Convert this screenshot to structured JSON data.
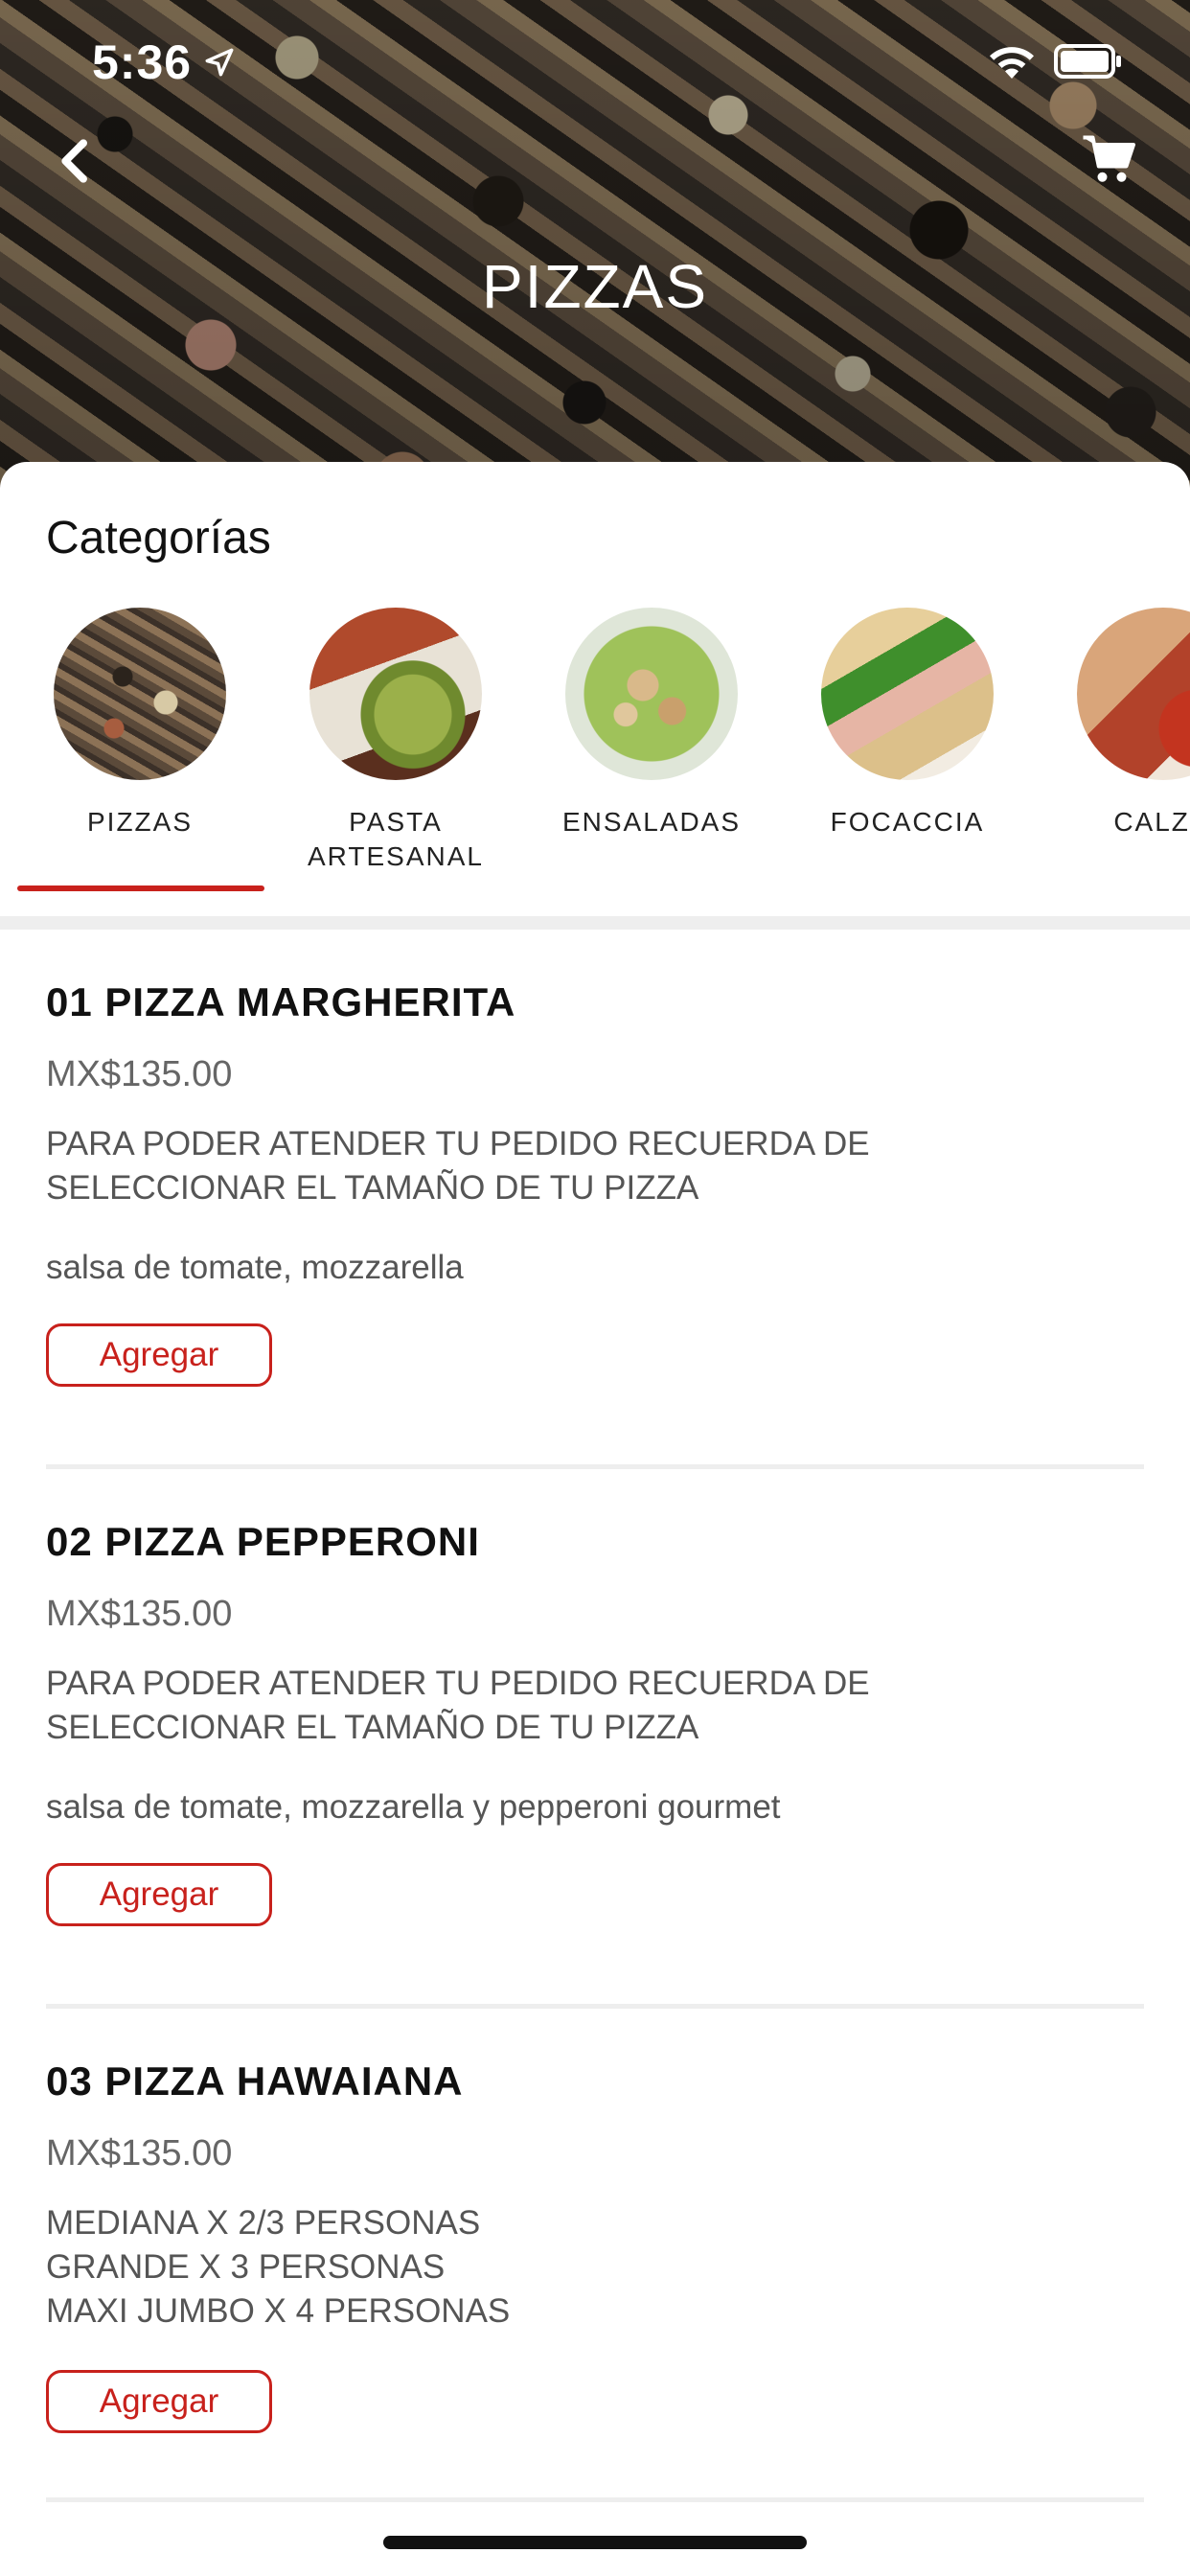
{
  "status_bar": {
    "time": "5:36"
  },
  "header": {
    "title": "PIZZAS",
    "back_icon": "chevron-left-icon",
    "cart_icon": "cart-icon"
  },
  "categories": {
    "heading": "Categorías",
    "items": [
      {
        "label": "PIZZAS",
        "selected": true,
        "image": "pizza-photo"
      },
      {
        "label": "PASTA\nARTESANAL",
        "selected": false,
        "image": "pasta-photo"
      },
      {
        "label": "ENSALADAS",
        "selected": false,
        "image": "salad-photo"
      },
      {
        "label": "FOCACCIA",
        "selected": false,
        "image": "sandwich-photo"
      },
      {
        "label": "CALZO",
        "selected": false,
        "image": "calzone-photo"
      }
    ]
  },
  "products": [
    {
      "name": "01 PIZZA MARGHERITA",
      "price": "MX$135.00",
      "note": "PARA PODER ATENDER TU PEDIDO RECUERDA DE\nSELECCIONAR EL TAMAÑO DE TU PIZZA",
      "ingredients": "salsa de tomate, mozzarella",
      "button": "Agregar"
    },
    {
      "name": "02 PIZZA PEPPERONI",
      "price": "MX$135.00",
      "note": "PARA PODER ATENDER TU PEDIDO RECUERDA DE\nSELECCIONAR EL TAMAÑO DE TU PIZZA",
      "ingredients": "salsa de tomate, mozzarella y pepperoni gourmet",
      "button": "Agregar"
    },
    {
      "name": "03 PIZZA HAWAIANA",
      "price": "MX$135.00",
      "note": "MEDIANA X 2/3 PERSONAS\nGRANDE X 3 PERSONAS\nMAXI JUMBO X 4 PERSONAS",
      "ingredients": "",
      "button": "Agregar"
    }
  ],
  "colors": {
    "accent": "#c8211c",
    "text_primary": "#111111",
    "text_secondary": "#555555"
  }
}
